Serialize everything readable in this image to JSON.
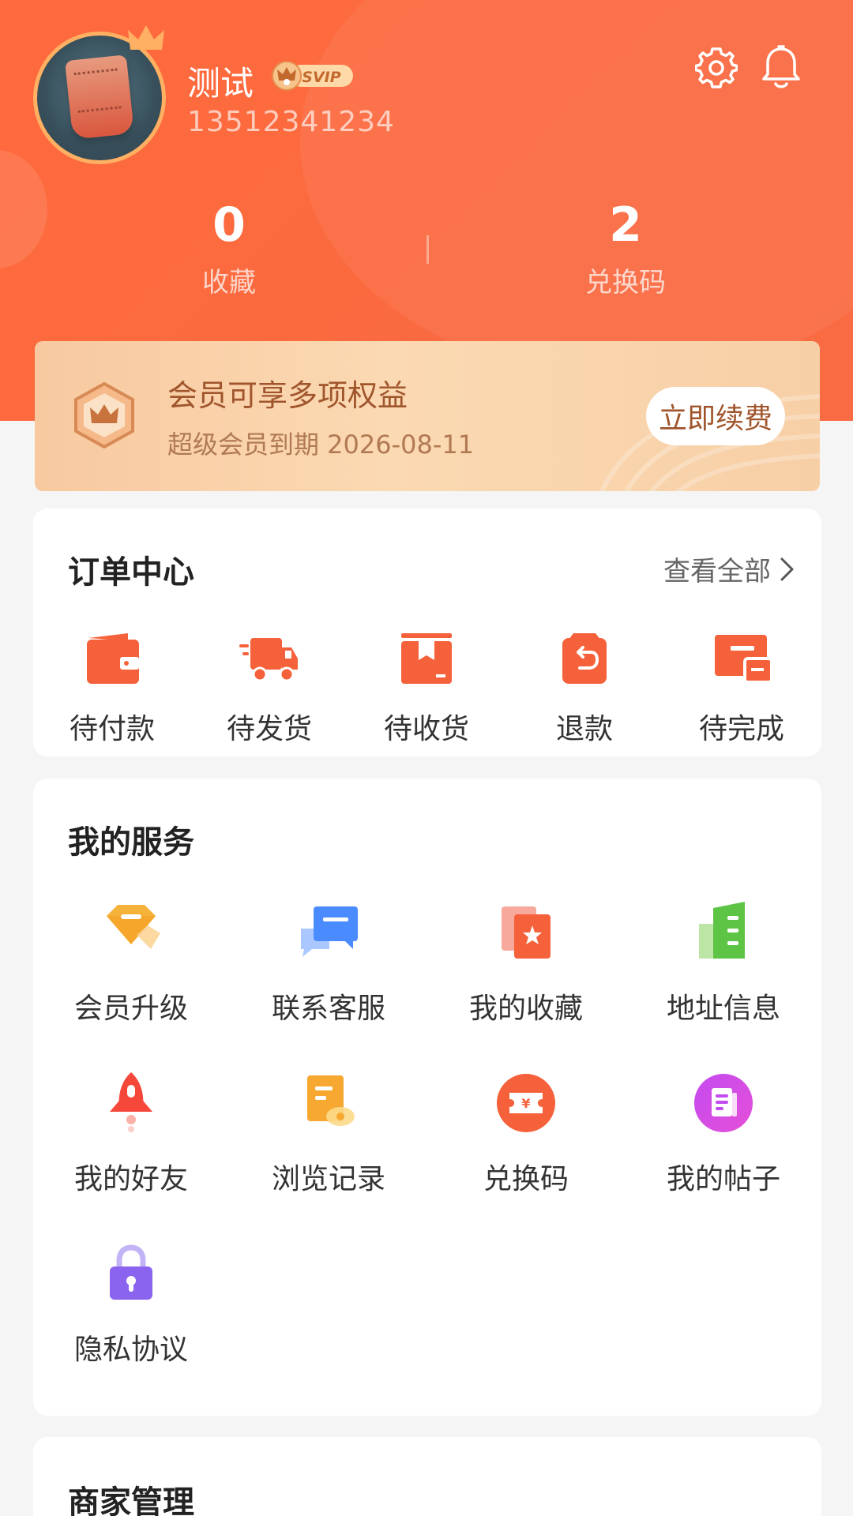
{
  "profile": {
    "name": "测试",
    "badge": "SVIP",
    "phone": "13512341234"
  },
  "stats": [
    {
      "value": "0",
      "label": "收藏"
    },
    {
      "value": "2",
      "label": "兑换码"
    }
  ],
  "vip_banner": {
    "title": "会员可享多项权益",
    "subtitle": "超级会员到期 2026-08-11",
    "button": "立即续费"
  },
  "orders": {
    "title": "订单中心",
    "view_all": "查看全部",
    "items": [
      {
        "label": "待付款",
        "icon": "wallet-icon"
      },
      {
        "label": "待发货",
        "icon": "truck-icon"
      },
      {
        "label": "待收货",
        "icon": "package-icon"
      },
      {
        "label": "退款",
        "icon": "refund-icon"
      },
      {
        "label": "待完成",
        "icon": "ticket-icon"
      }
    ]
  },
  "services": {
    "title": "我的服务",
    "items": [
      {
        "label": "会员升级",
        "icon": "diamond-icon"
      },
      {
        "label": "联系客服",
        "icon": "chat-icon"
      },
      {
        "label": "我的收藏",
        "icon": "star-card-icon"
      },
      {
        "label": "地址信息",
        "icon": "building-icon"
      },
      {
        "label": "我的好友",
        "icon": "rocket-icon"
      },
      {
        "label": "浏览记录",
        "icon": "history-icon"
      },
      {
        "label": "兑换码",
        "icon": "coupon-icon"
      },
      {
        "label": "我的帖子",
        "icon": "post-icon"
      },
      {
        "label": "隐私协议",
        "icon": "lock-icon"
      }
    ]
  },
  "merchant": {
    "title": "商家管理"
  },
  "colors": {
    "brand": "#fb6a3f",
    "order_icon": "#f5613a",
    "vip_text": "#a0552c"
  }
}
